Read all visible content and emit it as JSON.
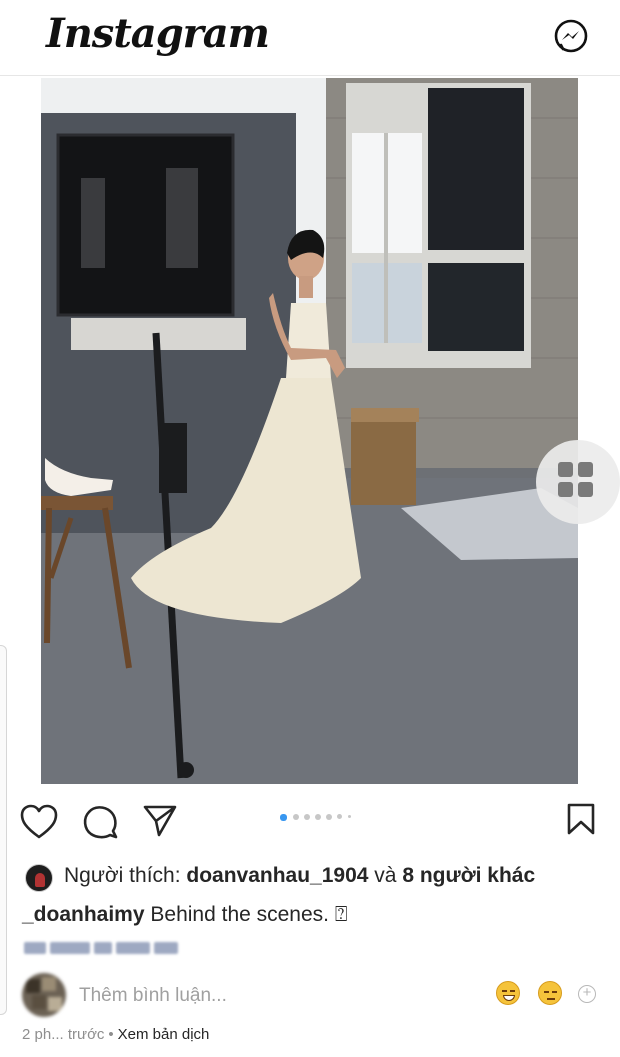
{
  "header": {
    "logo_text": "Instagram",
    "messenger_icon": "messenger-icon"
  },
  "post": {
    "photo_description_icon": "photo",
    "carousel": {
      "total": 7,
      "active_index": 0
    },
    "actions": {
      "like_icon": "heart-icon",
      "comment_icon": "comment-icon",
      "share_icon": "send-icon",
      "save_icon": "bookmark-icon"
    },
    "likes": {
      "prefix": "Người thích: ",
      "user": "doanvanhau_1904",
      "joiner": " và ",
      "others": "8 người khác"
    },
    "caption": {
      "username": "_doanhaimy",
      "text": " Behind the scenes. ⍰"
    },
    "comment": {
      "placeholder": "Thêm bình luận..."
    },
    "footer": {
      "time": "2 ph... trước",
      "separator": "•",
      "translate": "Xem bản dịch"
    }
  },
  "colors": {
    "accent_blue": "#3897f0",
    "text": "#262626",
    "muted": "#8e8e8e"
  }
}
